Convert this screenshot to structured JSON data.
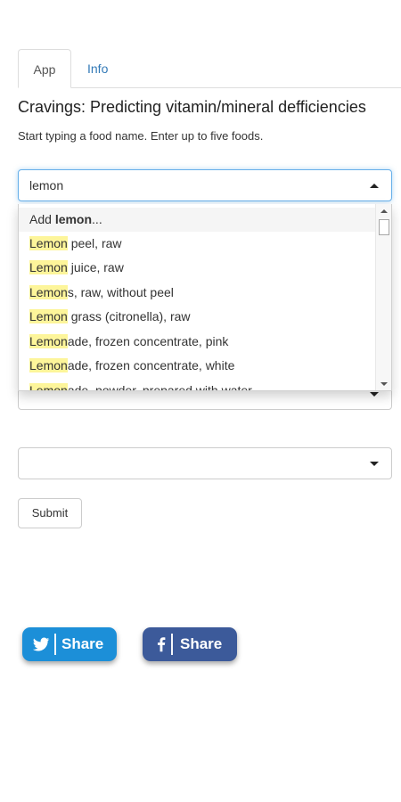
{
  "tabs": [
    {
      "label": "App",
      "active": true
    },
    {
      "label": "Info",
      "active": false
    }
  ],
  "title": "Cravings: Predicting vitamin/mineral defficiencies",
  "subtitle": "Start typing a food name. Enter up to five foods.",
  "food_inputs": [
    {
      "value": "lemon",
      "open": true
    },
    {
      "value": "",
      "open": false
    },
    {
      "value": "",
      "open": false
    }
  ],
  "dropdown": {
    "add_prefix": "Add ",
    "add_term": "lemon",
    "add_suffix": "...",
    "options": [
      {
        "match": "Lemon",
        "rest": " peel, raw"
      },
      {
        "match": "Lemon",
        "rest": " juice, raw"
      },
      {
        "match": "Lemon",
        "rest": "s, raw, without peel"
      },
      {
        "match": "Lemon",
        "rest": " grass (citronella), raw"
      },
      {
        "match": "Lemon",
        "rest": "ade, frozen concentrate, pink"
      },
      {
        "match": "Lemon",
        "rest": "ade, frozen concentrate, white"
      },
      {
        "match": "Lemon",
        "rest": "ade, powder, prepared with water"
      }
    ]
  },
  "submit_label": "Submit",
  "share": {
    "twitter": {
      "label": "Share",
      "icon": "twitter-bird-icon",
      "color": "#1c8fd8"
    },
    "facebook": {
      "label": "Share",
      "icon": "facebook-f-icon",
      "color": "#3c5a9a"
    }
  },
  "colors": {
    "highlight": "#fdf59a",
    "link": "#337ab7",
    "focus": "#66afe9"
  }
}
